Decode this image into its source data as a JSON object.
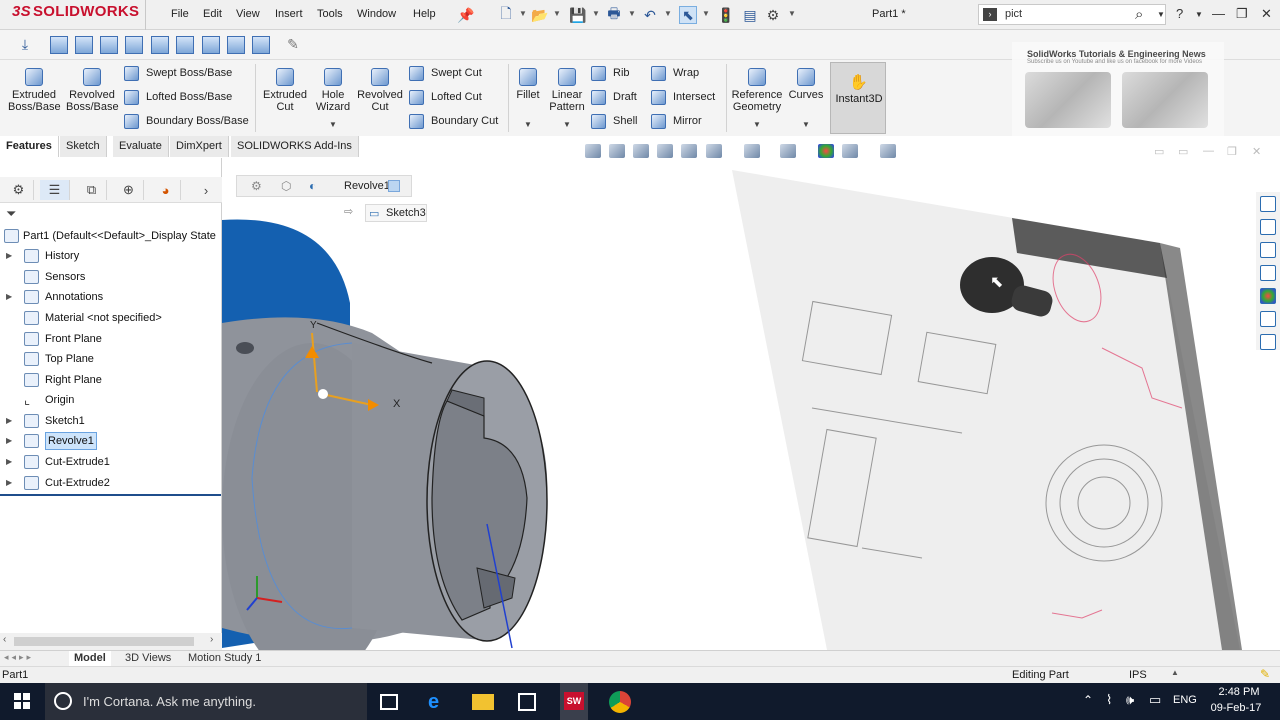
{
  "app": {
    "brand": "SOLIDWORKS",
    "document_title": "Part1 *",
    "menus": [
      "File",
      "Edit",
      "View",
      "Insert",
      "Tools",
      "Window",
      "Help"
    ],
    "search_value": "pict"
  },
  "command_manager": {
    "buttons": {
      "extruded_boss": "Extruded\nBoss/Base",
      "revolved_boss": "Revolved\nBoss/Base",
      "swept_boss": "Swept Boss/Base",
      "lofted_boss": "Lofted Boss/Base",
      "boundary_boss": "Boundary Boss/Base",
      "extruded_cut": "Extruded\nCut",
      "hole_wizard": "Hole\nWizard",
      "revolved_cut": "Revolved\nCut",
      "swept_cut": "Swept Cut",
      "lofted_cut": "Lofted Cut",
      "boundary_cut": "Boundary Cut",
      "fillet": "Fillet",
      "linear_pattern": "Linear\nPattern",
      "rib": "Rib",
      "draft": "Draft",
      "shell": "Shell",
      "wrap": "Wrap",
      "intersect": "Intersect",
      "mirror": "Mirror",
      "reference_geometry": "Reference\nGeometry",
      "curves": "Curves",
      "instant3d": "Instant3D"
    },
    "tabs": [
      "Features",
      "Sketch",
      "Evaluate",
      "DimXpert",
      "SOLIDWORKS Add-Ins"
    ],
    "active_tab": "Features"
  },
  "news": {
    "title": "SolidWorks Tutorials & Engineering News",
    "subtitle": "Subscribe us on Youtube and like us on facebook for more Videos"
  },
  "feature_tree": {
    "root": "Part1  (Default<<Default>_Display State",
    "items": [
      {
        "label": "History",
        "expandable": true
      },
      {
        "label": "Sensors",
        "expandable": false
      },
      {
        "label": "Annotations",
        "expandable": true
      },
      {
        "label": "Material <not specified>",
        "expandable": false
      },
      {
        "label": "Front Plane",
        "expandable": false
      },
      {
        "label": "Top Plane",
        "expandable": false
      },
      {
        "label": "Right Plane",
        "expandable": false
      },
      {
        "label": "Origin",
        "expandable": false
      },
      {
        "label": "Sketch1",
        "expandable": true
      },
      {
        "label": "Revolve1",
        "expandable": true,
        "selected": true
      },
      {
        "label": "Cut-Extrude1",
        "expandable": true
      },
      {
        "label": "Cut-Extrude2",
        "expandable": true
      }
    ]
  },
  "viewport": {
    "breadcrumb_feature": "Revolve1",
    "breadcrumb_sketch": "Sketch3",
    "axis_x": "X",
    "axis_y": "Y"
  },
  "bottom_tabs": [
    "Model",
    "3D Views",
    "Motion Study 1"
  ],
  "active_bottom_tab": "Model",
  "status": {
    "left": "Part1",
    "mode": "Editing Part",
    "units": "IPS"
  },
  "taskbar": {
    "cortana_placeholder": "I'm Cortana. Ask me anything.",
    "language": "ENG",
    "time": "2:48 PM",
    "date": "09-Feb-17"
  },
  "colors": {
    "brand_red": "#c8102e",
    "part_gray": "#8a8e96",
    "flange_blue": "#1460b0",
    "selection_blue": "#cde4fb",
    "taskbar": "#101a2c"
  }
}
